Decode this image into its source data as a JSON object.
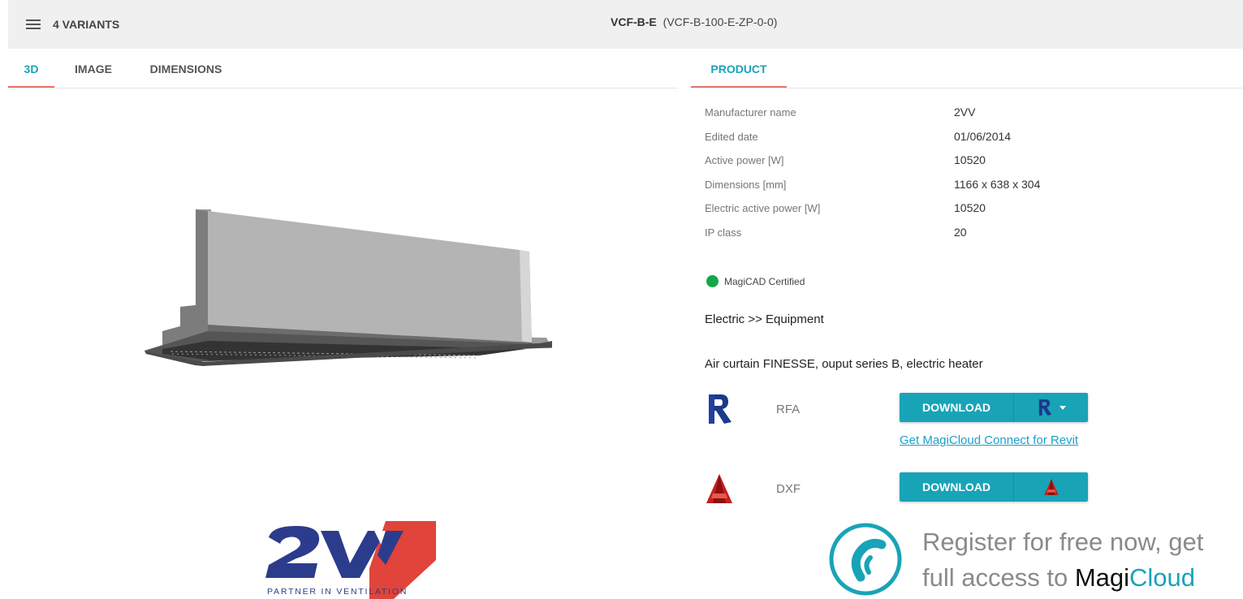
{
  "header": {
    "variants_label": "4 VARIANTS",
    "title_main": "VCF-B-E",
    "title_code": "(VCF-B-100-E-ZP-0-0)",
    "menu_icon": "hamburger-menu-icon"
  },
  "view_tabs": [
    {
      "label": "3D",
      "active": true
    },
    {
      "label": "IMAGE",
      "active": false
    },
    {
      "label": "DIMENSIONS",
      "active": false
    }
  ],
  "info_tabs": [
    {
      "label": "PRODUCT",
      "active": true
    }
  ],
  "properties": [
    {
      "key": "Manufacturer name",
      "value": "2VV"
    },
    {
      "key": "Edited date",
      "value": "01/06/2014"
    },
    {
      "key": "Active power [W]",
      "value": "10520"
    },
    {
      "key": "Dimensions [mm]",
      "value": "1166 x 638 x 304"
    },
    {
      "key": "Electric active power [W]",
      "value": "10520"
    },
    {
      "key": "IP class",
      "value": "20"
    }
  ],
  "certification": {
    "label": "MagiCAD Certified",
    "status_color": "#12a84a"
  },
  "category": "Electric >> Equipment",
  "description": "Air curtain FINESSE, ouput series B, electric heater",
  "downloads": [
    {
      "type": "RFA",
      "button_label": "DOWNLOAD",
      "icon": "revit-icon",
      "has_dropdown": true
    },
    {
      "type": "DXF",
      "button_label": "DOWNLOAD",
      "icon": "autocad-icon",
      "has_dropdown": false
    }
  ],
  "magicloud_connect_link": "Get MagiCloud Connect for Revit",
  "manufacturer_logo": {
    "text": "2VV",
    "tagline": "PARTNER IN VENTILATION"
  },
  "promo": {
    "line1": "Register for free now, get",
    "line2_prefix": "full access to ",
    "brand_part1": "Magi",
    "brand_part2": "Cloud"
  },
  "colors": {
    "accent": "#19a3b7",
    "tab_underline": "#e8736a",
    "header_bg": "#f0f0f0",
    "certified_green": "#12a84a",
    "link": "#1e9fc9"
  }
}
